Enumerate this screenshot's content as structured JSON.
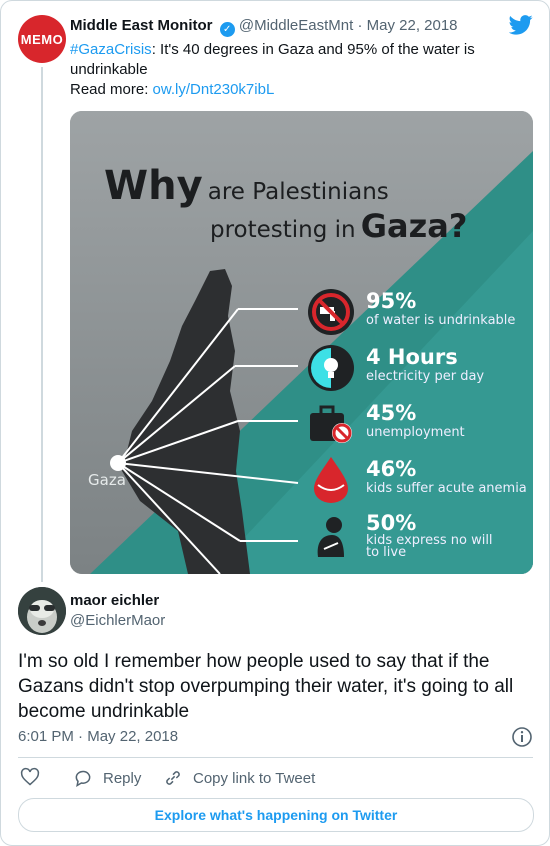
{
  "quoted_tweet": {
    "author_name": "Middle East Monitor",
    "handle": "@MiddleEastMnt",
    "separator": "·",
    "date": "May 22, 2018",
    "avatar_text": "MEMO",
    "hashtag": "#GazaCrisis",
    "text_rest": ": It's 40 degrees in Gaza and 95% of the water is undrinkable",
    "read_more_label": "Read more:",
    "read_more_link": "ow.ly/Dnt230k7ibL"
  },
  "infographic": {
    "title_why": "Why",
    "title_rest_line1": "are Palestinians",
    "title_rest_line2": "protesting in",
    "title_gaza": "Gaza?",
    "location_label": "Gaza",
    "stats": [
      {
        "big": "95%",
        "small": "of water is undrinkable",
        "icon": "no-water-icon"
      },
      {
        "big": "4 Hours",
        "small": "electricity per day",
        "icon": "lightbulb-icon"
      },
      {
        "big": "45%",
        "small": "unemployment",
        "icon": "briefcase-icon"
      },
      {
        "big": "46%",
        "small": "kids suffer acute anemia",
        "icon": "blood-drop-icon"
      },
      {
        "big": "50%",
        "small": "kids express no will to live",
        "small_line1": "kids express no will",
        "small_line2": "to live",
        "icon": "sad-child-icon"
      }
    ]
  },
  "main_tweet": {
    "author_name": "maor eichler",
    "handle": "@EichlerMaor",
    "text": "I'm so old I remember how people used to say that if the Gazans didn't stop overpumping their water, it's going to all become undrinkable",
    "time": "6:01 PM",
    "separator": "·",
    "date": "May 22, 2018"
  },
  "actions": {
    "reply_label": "Reply",
    "copy_link_label": "Copy link to Tweet"
  },
  "explore_label": "Explore what's happening on Twitter",
  "colors": {
    "twitter_blue": "#1d9bf0",
    "memo_red": "#d8262c",
    "teal": "#2f8f87",
    "icon_red": "#d8262c"
  }
}
